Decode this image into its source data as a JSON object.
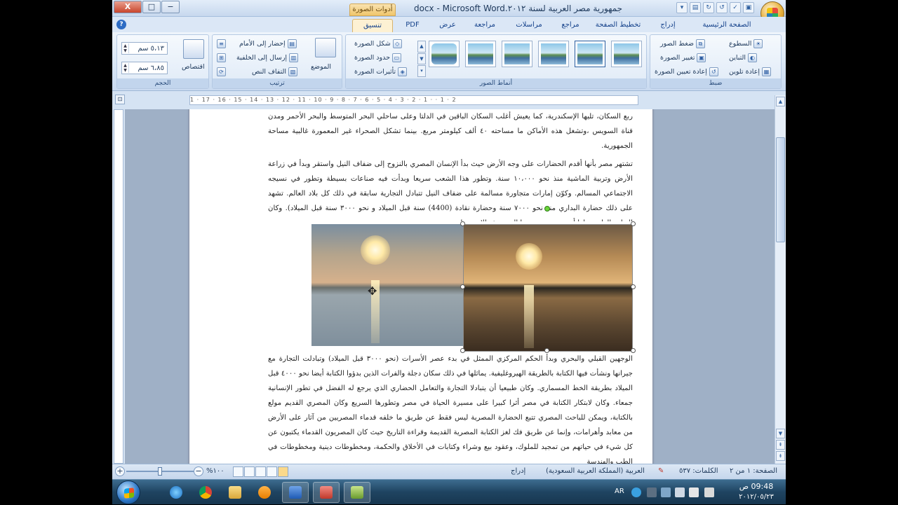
{
  "window": {
    "title": "جمهورية مصر العربية لسنة ٢٠١٢.docx - Microsoft Word",
    "context_tab_group": "أدوات الصورة",
    "controls": {
      "minimize": "−",
      "maximize": "□",
      "close": "X"
    }
  },
  "ribbon_tabs": [
    {
      "label": "الصفحة الرئيسية"
    },
    {
      "label": "إدراج"
    },
    {
      "label": "تخطيط الصفحة"
    },
    {
      "label": "مراجع"
    },
    {
      "label": "مراسلات"
    },
    {
      "label": "مراجعة"
    },
    {
      "label": "عرض"
    },
    {
      "label": "PDF"
    },
    {
      "label": "تنسيق",
      "active": true
    }
  ],
  "ribbon": {
    "adjust": {
      "label": "ضبط",
      "brightness": "السطوع",
      "contrast": "التباين",
      "recolor": "إعادة تلوين",
      "compress": "ضغط الصور",
      "change_picture": "تغيير الصورة",
      "reset_picture": "إعادة تعيين الصورة"
    },
    "picture_styles": {
      "label": "أنماط الصور",
      "shape": "شكل الصورة",
      "border": "حدود الصورة",
      "effects": "تأثيرات الصورة"
    },
    "arrange": {
      "label": "ترتيب",
      "position": "الموضع",
      "bring_front": "إحضار إلى الأمام",
      "send_back": "إرسال إلى الخلفية",
      "text_wrap": "التفاف النص"
    },
    "size": {
      "label": "الحجم",
      "crop": "اقتصاص",
      "height": "٥،١٣ سم",
      "width": "٦،٨٥ سم"
    }
  },
  "ruler_text": "1 · 17 · 16 · 15 · 14 · 13 · 12 · 11 · 10 · 9 · 8 · 7 · 6 · 5 · 4 · 3 · 2 · 1 · · 1 · 2",
  "document": {
    "para1": "ربع السكان، تليها الإسكندرية، كما يعيش أغلب السكان الباقين في الدلتا وعلى ساحلي البحر المتوسط والبحر الأحمر ومدن قناة السويس ،وتشغل هذه الأماكن ما مساحته ٤٠ ألف كيلومتر مربع. بينما تشكل الصحراء غير المعمورة غالبية مساحة الجمهورية.",
    "para2": "تشتهر مصر بأنها أقدم الحضارات على وجه الأرض حيث بدأ الإنسان المصري بالنزوح إلى ضفاف النيل واستقر وبدأ في زراعة الأرض وتربية الماشية منذ نحو ١٠،٠٠٠ سنة. وتطور هذا الشعب سريعا وبدأت فيه صناعات بسيطة وتطور في نسيجه الاجتماعي المسالم. وكوّن إمارات متجاورة مسالمة على ضفاف النيل تتبادل التجارية سابقة في ذلك كل بلاد العالم. تشهد على ذلك حضارة البداري منذ نحو ٧٠٠٠ سنة وحضارة نقادة (4400) سنة قبل الميلاد و نحو ٣٠٠٠ سنة قبل الميلاد). وكان التطور الطبيعي لها أن تندمج مع بعضها البعض شمالا وجنوبا وتوحيد",
    "para3": "الوجهين القبلي والبحري وبدأ الحكم المركزي الممثل في بدء عصر الأسرات (نحو ٣٠٠٠ قبل الميلاد) وتبادلت التجارة مع جيرانها ونشأت فيها الكتابة بالطريقة الهيروغليفية. يماثلها في ذلك سكان دجلة والفرات الذين بدؤوا الكتابة أيضا نحو ٤٠٠٠ قبل الميلاد بطريقة الخط المسماري. وكان طبيعيا أن يتبادلا التجارة والتعامل الحضاري الذي يرجع له الفضل في تطور الإنسانية جمعاء. وكان لابتكار الكتابة في مصر أثرا كبيرا على مسيرة الحياة في مصر وتطورها السريع وكان المصري القديم مولع بالكتابة، ويمكن للباحث المصري تتبع الحضارة المصرية ليس فقط عن طريق ما خلفه قدماء المصريين من آثار على الأرض من معابد وأهرامات، وإنما عن طريق فك لغز الكتابة المصرية القديمة وقراءة التاريخ حيث كان المصريون القدماء يكتبون عن كل شيء في حياتهم من تمجيد للملوك، وعقود بيع وشراء وكتابات في الأخلاق والحكمة، ومخطوطات دينية ومخطوطات في الطب والهندسة"
  },
  "statusbar": {
    "page": "الصفحة: ١ من ٢",
    "words": "الكلمات: ٥٣٧",
    "language": "العربية (المملكة العربية السعودية)",
    "mode": "إدراج",
    "zoom": "١٠٠%",
    "zoom_fraction": 0.5
  },
  "taskbar": {
    "language": "AR",
    "time": "09:48 ص",
    "date": "٢٠١٢/٠٥/٢٣"
  },
  "colors": {
    "ribbon_bg": "#d5e3f3",
    "active_tab": "#fdf1d3",
    "taskbar": "#1f4461"
  }
}
